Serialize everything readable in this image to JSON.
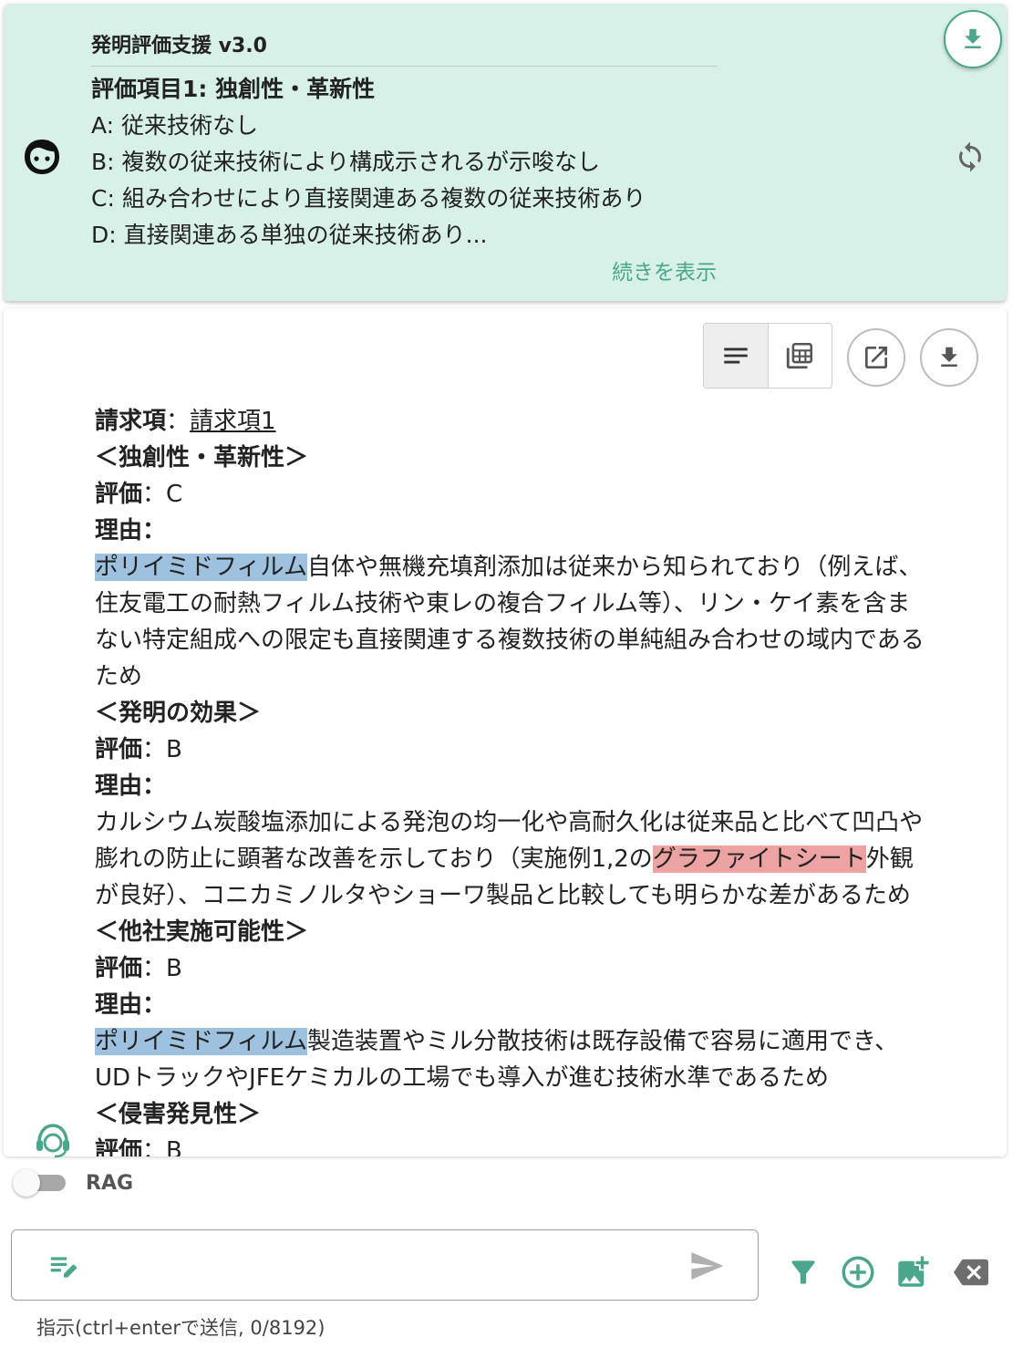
{
  "assistant_card": {
    "title": "発明評価支援 v3.0",
    "heading": "評価項目1: 独創性・革新性",
    "lines": [
      "A: 従来技術なし",
      "B: 複数の従来技術により構成示されるが示唆なし",
      "C: 組み合わせにより直接関連ある複数の従来技術あり",
      "D: 直接関連ある単独の従来技術あり..."
    ],
    "show_more": "続きを表示"
  },
  "response": {
    "claim_label": "請求項",
    "claim_sep": "：",
    "claim_link": "請求項1",
    "sections": [
      {
        "heading": "＜独創性・革新性＞",
        "rating_label": "評価",
        "rating_sep": "：",
        "rating": "C",
        "reason_label": "理由：",
        "reason_lines": [
          {
            "hl": "ポリイミドフィルム",
            "text": "自体や無機充填剤添加は従来から知られており（例えば、"
          },
          {
            "text": "住友電工の耐熱フィルム技術や東レの複合フィルム等）、リン・ケイ素を含ま"
          },
          {
            "text": "ない特定組成への限定も直接関連する複数技術の単純組み合わせの域内である"
          },
          {
            "text": "ため"
          }
        ]
      },
      {
        "heading": "＜発明の効果＞",
        "rating_label": "評価",
        "rating_sep": "：",
        "rating": "B",
        "reason_label": "理由：",
        "reason_lines": [
          {
            "text": "カルシウム炭酸塩添加による発泡の均一化や高耐久化は従来品と比べて凹凸や"
          },
          {
            "pre": "膨れの防止に顕著な改善を示しており（実施例1,2の",
            "hl_red": "グラファイトシート",
            "post": "外観"
          },
          {
            "text": "が良好）、コニカミノルタやショーワ製品と比較しても明らかな差があるため"
          }
        ]
      },
      {
        "heading": "＜他社実施可能性＞",
        "rating_label": "評価",
        "rating_sep": "：",
        "rating": "B",
        "reason_label": "理由：",
        "reason_lines": [
          {
            "hl": "ポリイミドフィルム",
            "text": "製造装置やミル分散技術は既存設備で容易に適用でき、"
          },
          {
            "text": "UDトラックやJFEケミカルの工場でも導入が進む技術水準であるため"
          }
        ]
      },
      {
        "heading": "＜侵害発見性＞",
        "rating_label": "評価",
        "rating_sep": "：",
        "rating": "B"
      }
    ]
  },
  "rag": {
    "label": "RAG",
    "enabled": false
  },
  "chat": {
    "value": "",
    "hint": "指示(ctrl+enterで送信, 0/8192)"
  },
  "colors": {
    "card_bg": "#d7f0e8",
    "accent_teal": "#4aa68c",
    "highlight_blue": "#9dc1df",
    "highlight_red": "#eea3a3"
  }
}
